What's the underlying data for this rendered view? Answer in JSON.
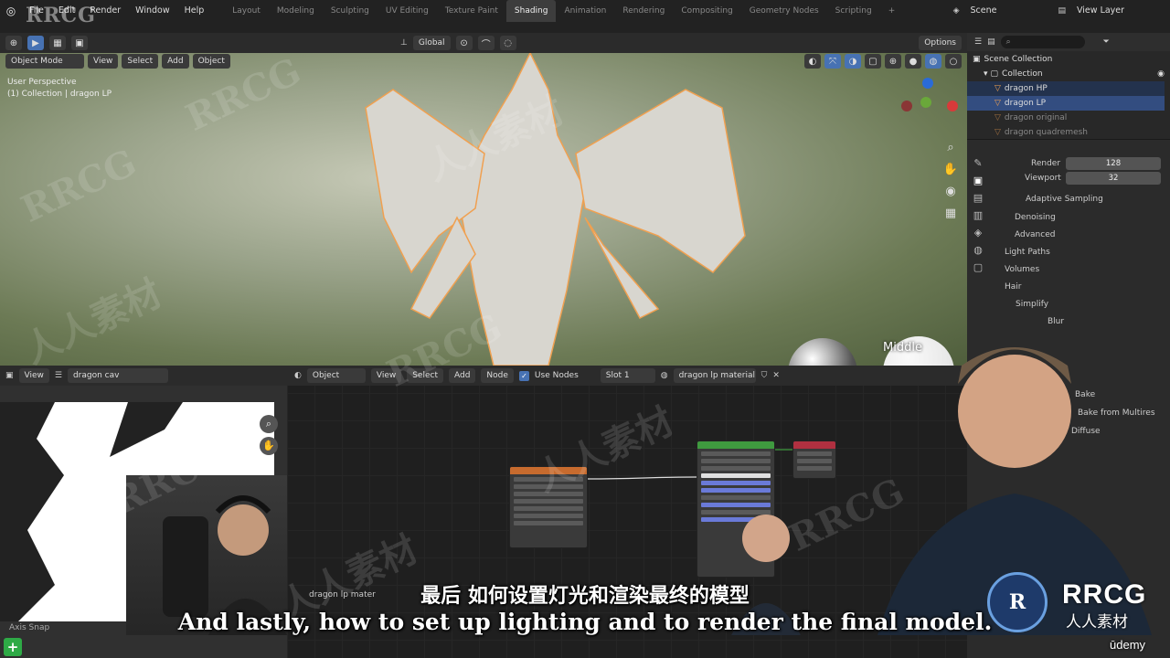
{
  "menubar": {
    "menus": [
      "File",
      "Edit",
      "Render",
      "Window",
      "Help"
    ],
    "workspaces": [
      "Layout",
      "Modeling",
      "Sculpting",
      "UV Editing",
      "Texture Paint",
      "Shading",
      "Animation",
      "Rendering",
      "Compositing",
      "Geometry Nodes",
      "Scripting"
    ],
    "active_workspace": "Shading",
    "scene": "Scene",
    "view_layer": "View Layer"
  },
  "header_logo": "RRCG",
  "viewport_header": {
    "transform": "Global",
    "options": "Options",
    "mode": "Object Mode",
    "menus": [
      "View",
      "Select",
      "Add",
      "Object"
    ]
  },
  "viewport": {
    "perspective": "User Perspective",
    "collection_path": "(1) Collection | dragon LP",
    "hdri_label": "Middle"
  },
  "outliner": {
    "root": "Scene Collection",
    "collection": "Collection",
    "items": [
      "dragon HP",
      "dragon LP",
      "dragon original",
      "dragon quadremesh"
    ]
  },
  "properties": {
    "render_label": "Render",
    "render_value": "128",
    "viewport_label": "Viewport",
    "viewport_value": "32",
    "sections": [
      "Adaptive Sampling",
      "Denoising",
      "Advanced",
      "Light Paths",
      "Volumes",
      "Hair",
      "Simplify",
      "Blur"
    ],
    "bake": "Bake",
    "bake_multires": "Bake from Multires",
    "bake_type": "Diffuse"
  },
  "uv_editor": {
    "view": "View",
    "image": "dragon cav",
    "footer": "Axis Snap"
  },
  "node_editor": {
    "object": "Object",
    "menus": [
      "View",
      "Select",
      "Add",
      "Node"
    ],
    "use_nodes": "Use Nodes",
    "slot": "Slot 1",
    "material": "dragon lp material",
    "footer_material": "dragon lp mater"
  },
  "subtitles": {
    "chinese": "最后 如何设置灯光和渲染最终的模型",
    "english": "And lastly, how to set up lighting and to render the final model."
  },
  "branding": {
    "logo_text": "RRCG",
    "logo_sub": "人人素材",
    "udemy": "ūdemy"
  },
  "colors": {
    "accent": "#4772b3",
    "selection": "#334d80",
    "orange_outline": "#f0a050"
  }
}
